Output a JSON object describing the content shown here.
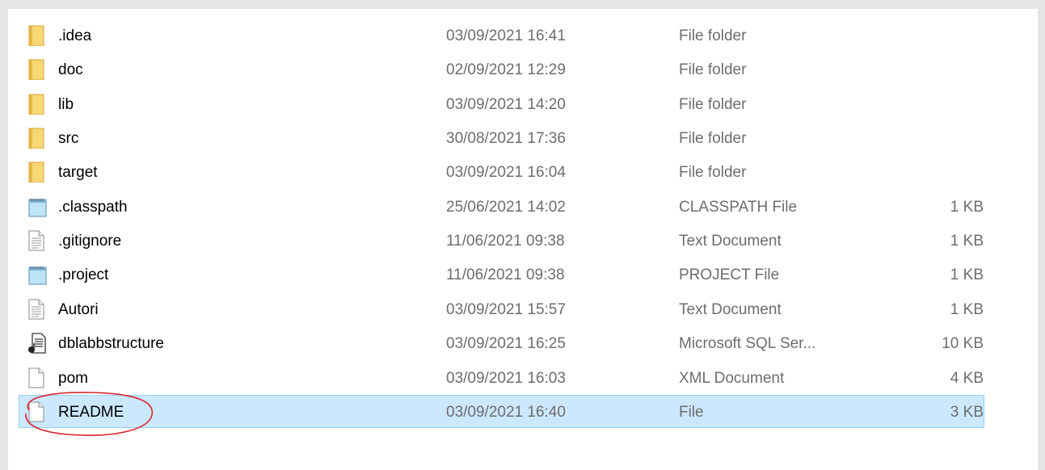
{
  "files": [
    {
      "name": ".idea",
      "date": "03/09/2021 16:41",
      "type": "File folder",
      "size": "",
      "icon": "folder-icon"
    },
    {
      "name": "doc",
      "date": "02/09/2021 12:29",
      "type": "File folder",
      "size": "",
      "icon": "folder-icon"
    },
    {
      "name": "lib",
      "date": "03/09/2021 14:20",
      "type": "File folder",
      "size": "",
      "icon": "folder-icon"
    },
    {
      "name": "src",
      "date": "30/08/2021 17:36",
      "type": "File folder",
      "size": "",
      "icon": "folder-icon"
    },
    {
      "name": "target",
      "date": "03/09/2021 16:04",
      "type": "File folder",
      "size": "",
      "icon": "folder-icon"
    },
    {
      "name": ".classpath",
      "date": "25/06/2021 14:02",
      "type": "CLASSPATH File",
      "size": "1 KB",
      "icon": "notepad-file-icon"
    },
    {
      "name": ".gitignore",
      "date": "11/06/2021 09:38",
      "type": "Text Document",
      "size": "1 KB",
      "icon": "text-document-icon"
    },
    {
      "name": ".project",
      "date": "11/06/2021 09:38",
      "type": "PROJECT File",
      "size": "1 KB",
      "icon": "notepad-file-icon"
    },
    {
      "name": "Autori",
      "date": "03/09/2021 15:57",
      "type": "Text Document",
      "size": "1 KB",
      "icon": "text-document-icon"
    },
    {
      "name": "dblabbstructure",
      "date": "03/09/2021 16:25",
      "type": "Microsoft SQL Ser...",
      "size": "10 KB",
      "icon": "sql-script-icon"
    },
    {
      "name": "pom",
      "date": "03/09/2021 16:03",
      "type": "XML Document",
      "size": "4 KB",
      "icon": "blank-file-icon"
    },
    {
      "name": "README",
      "date": "03/09/2021 16:40",
      "type": "File",
      "size": "3 KB",
      "icon": "blank-file-icon",
      "selected": true
    }
  ],
  "colors": {
    "selection_fill": "#cce8ff",
    "selection_border": "#99d1ff",
    "annotation_circle": "#d9232e",
    "folder": "#f8d775"
  }
}
